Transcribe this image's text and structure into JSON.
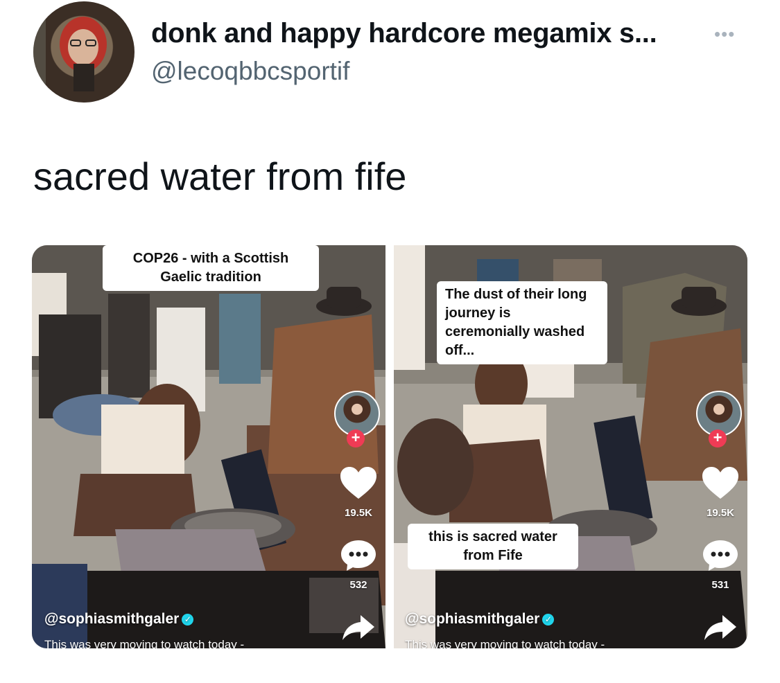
{
  "tweet": {
    "display_name": "donk and happy hardcore megamix s...",
    "handle": "@lecoqbbcsportif",
    "more_glyph": "•••",
    "text": "sacred water from fife"
  },
  "media": {
    "left": {
      "caption_top": "COP26 - with a Scottish Gaelic tradition",
      "likes": "19.5K",
      "comments": "532",
      "author": "@sophiasmithgaler",
      "description": "This was very moving to watch today -",
      "follow_glyph": "+"
    },
    "right": {
      "caption_top": "The dust of their long journey is ceremonially washed off...",
      "caption_bottom": "this is sacred water from Fife",
      "likes": "19.5K",
      "comments": "531",
      "author": "@sophiasmithgaler",
      "description": "This was very moving to watch today -",
      "follow_glyph": "+"
    }
  },
  "icons": {
    "verified": "✓",
    "more": "more-icon",
    "heart": "heart-icon",
    "comment": "comment-icon",
    "share": "share-icon"
  },
  "colors": {
    "handle": "#536471",
    "follow": "#ef3b55",
    "verified": "#20d5ec"
  }
}
